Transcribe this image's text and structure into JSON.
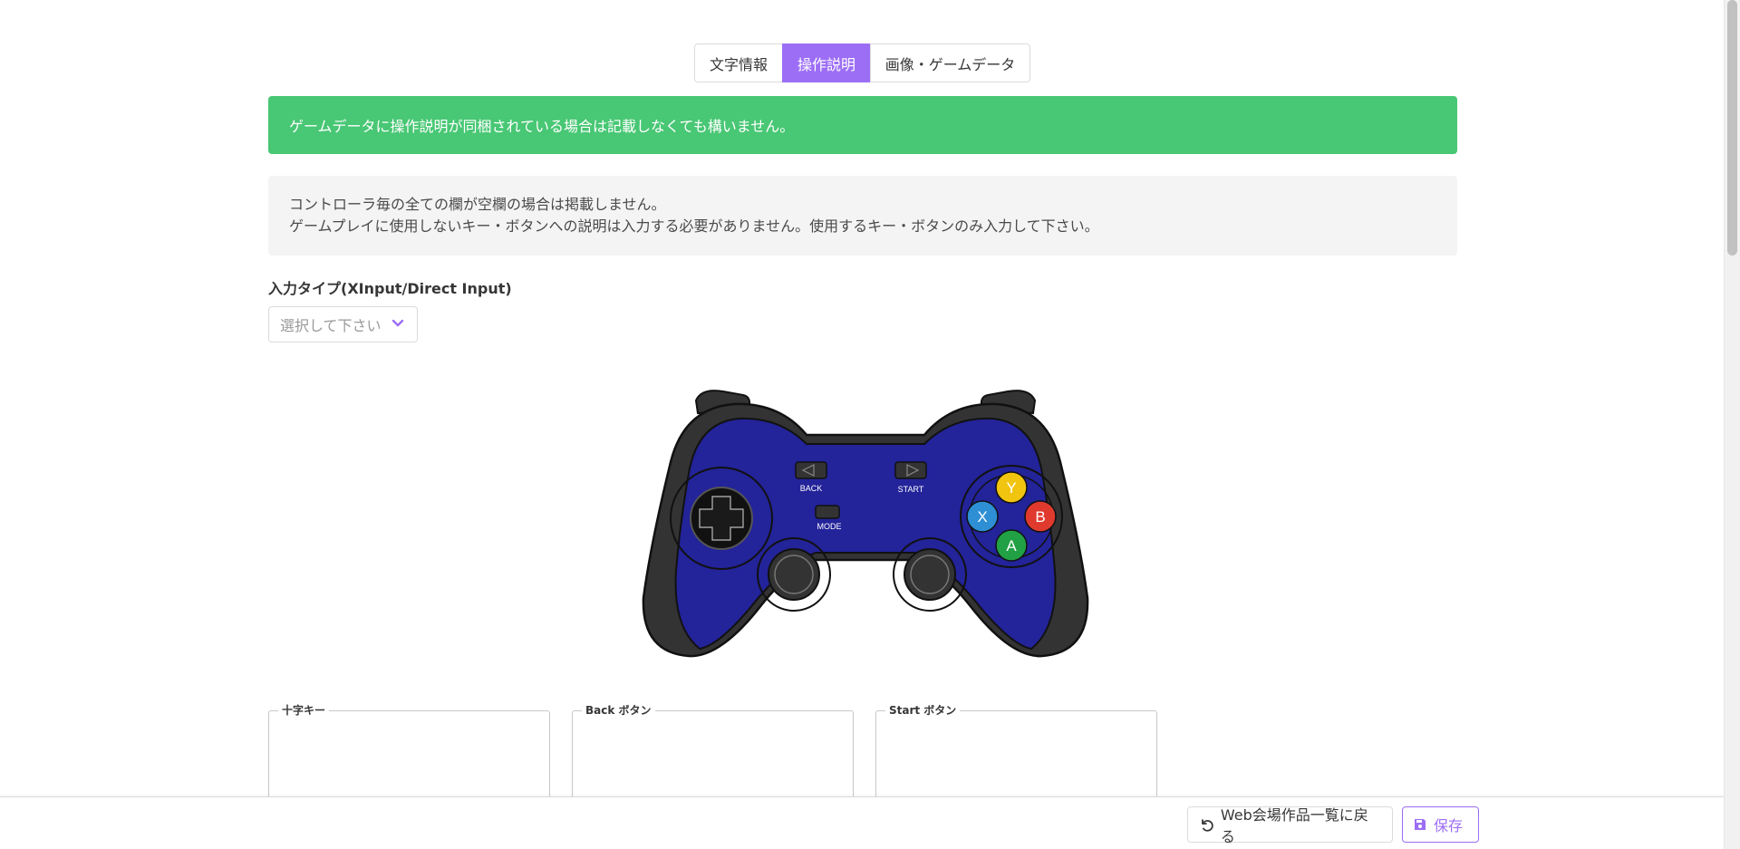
{
  "tabs": [
    {
      "label": "文字情報",
      "active": false
    },
    {
      "label": "操作説明",
      "active": true
    },
    {
      "label": "画像・ゲームデータ",
      "active": false
    }
  ],
  "notices": {
    "green": "ゲームデータに操作説明が同梱されている場合は記載しなくても構いません。",
    "gray_line1": "コントローラ毎の全ての欄が空欄の場合は掲載しません。",
    "gray_line2": "ゲームプレイに使用しないキー・ボタンへの説明は入力する必要がありません。使用するキー・ボタンのみ入力して下さい。"
  },
  "input_type": {
    "label": "入力タイプ(XInput/Direct Input)",
    "placeholder": "選択して下さい"
  },
  "gamepad": {
    "labels": {
      "back": "BACK",
      "start": "START",
      "mode": "MODE"
    },
    "face_buttons": {
      "y": "Y",
      "x": "X",
      "b": "B",
      "a": "A"
    },
    "colors": {
      "body": "#23239a",
      "grip": "#333333",
      "y": "#f1c40f",
      "x": "#2e8fd4",
      "b": "#e03a2e",
      "a": "#22a045"
    }
  },
  "fields": [
    {
      "label": "十字キー"
    },
    {
      "label": "Back ボタン"
    },
    {
      "label": "Start ボタン"
    }
  ],
  "footer": {
    "back_label": "Web会場作品一覧に戻る",
    "save_label": "保存"
  },
  "colors": {
    "accent": "#9c6ef5",
    "success": "#48c774"
  }
}
